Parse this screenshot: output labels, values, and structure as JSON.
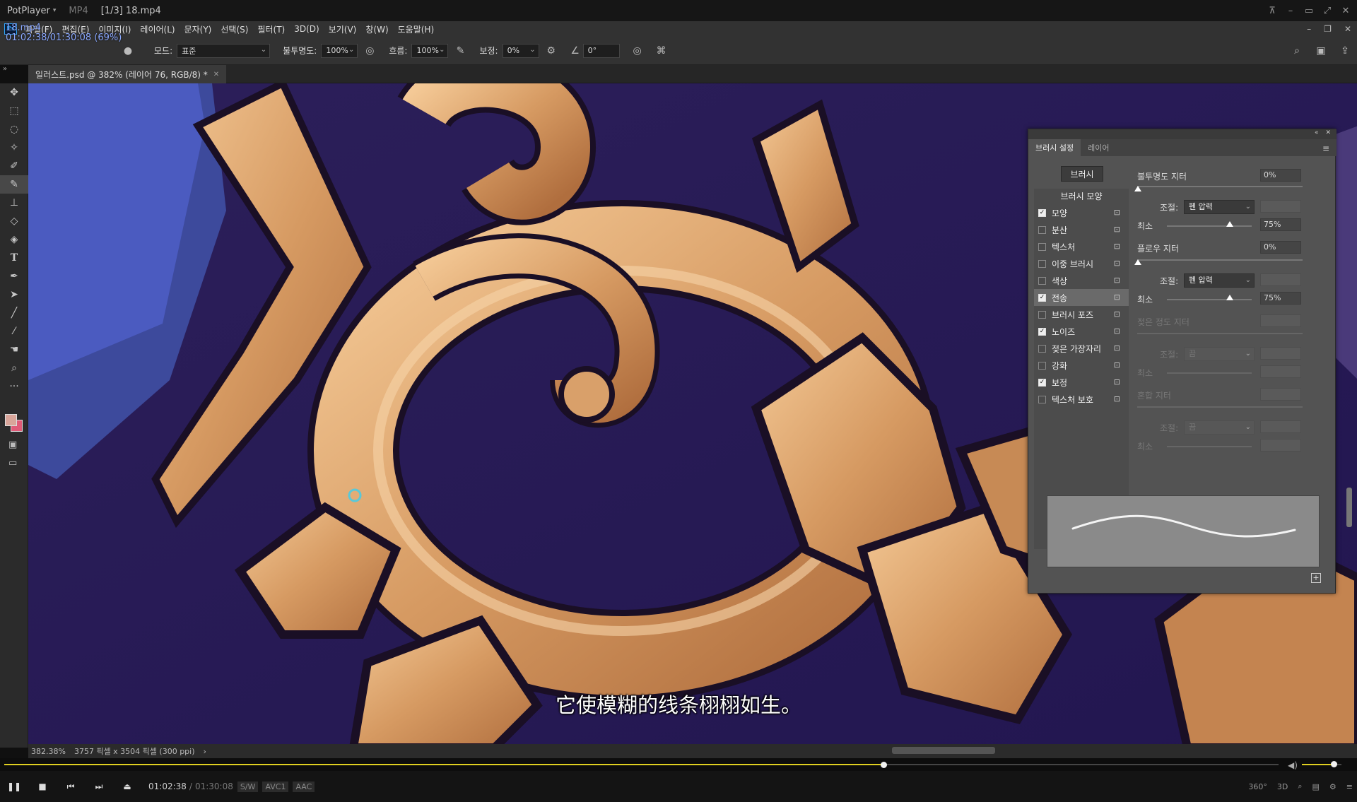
{
  "player": {
    "app_name": "PotPlayer",
    "format": "MP4",
    "title": "[1/3] 18.mp4",
    "osd_file": "18.mp4",
    "osd_time": "01:02:38/01:30:08 (69%)",
    "current_time": "01:02:38",
    "separator": "/",
    "duration": "01:30:08",
    "tags": [
      "S/W",
      "AVC1",
      "AAC"
    ],
    "progress_fraction": 0.69,
    "volume_fraction": 0.8,
    "right_buttons": [
      "360°",
      "3D"
    ],
    "subtitle": "它使模糊的线条栩栩如生。"
  },
  "photoshop": {
    "menu": [
      "파일(F)",
      "편집(E)",
      "이미지(I)",
      "레이어(L)",
      "문자(Y)",
      "선택(S)",
      "필터(T)",
      "3D(D)",
      "보기(V)",
      "창(W)",
      "도움말(H)"
    ],
    "options": {
      "mode_label": "모드:",
      "mode_value": "표준",
      "opacity_label": "불투명도:",
      "opacity_value": "100%",
      "flow_label": "흐름:",
      "flow_value": "100%",
      "smoothing_label": "보정:",
      "smoothing_value": "0%",
      "angle_value": "0°"
    },
    "doc_tab": "일러스트.psd @ 382% (레이어 76, RGB/8) *",
    "status_zoom": "382.38%",
    "status_info": "3757 픽셀 x 3504 픽셀 (300 ppi)",
    "status_arrow": "›",
    "fg_color": "#d9a59a",
    "bg_color": "#e05a78"
  },
  "brush_panel": {
    "tabs": [
      "브러시 설정",
      "레이어"
    ],
    "brush_button": "브러시",
    "shape_header": "브러시 모양",
    "items": [
      {
        "label": "모양",
        "checked": true
      },
      {
        "label": "분산",
        "checked": false
      },
      {
        "label": "텍스처",
        "checked": false
      },
      {
        "label": "이중 브러시",
        "checked": false
      },
      {
        "label": "색상",
        "checked": false
      },
      {
        "label": "전송",
        "checked": true,
        "selected": true
      },
      {
        "label": "브러시 포즈",
        "checked": false
      },
      {
        "label": "노이즈",
        "checked": true
      },
      {
        "label": "젖은 가장자리",
        "checked": false
      },
      {
        "label": "강화",
        "checked": false
      },
      {
        "label": "보정",
        "checked": true
      },
      {
        "label": "텍스처 보호",
        "checked": false
      }
    ],
    "opacity_jitter_label": "불투명도 지터",
    "opacity_jitter_value": "0%",
    "control_label": "조절:",
    "control_value": "펜 압력",
    "min_label": "최소",
    "min_value": "75%",
    "flow_jitter_label": "플로우 지터",
    "flow_jitter_value": "0%",
    "control2_value": "펜 압력",
    "min2_value": "75%",
    "wetness_jitter_label": "젖은 정도 지터",
    "control3_value": "끔",
    "min3_label": "최소",
    "mix_jitter_label": "혼합 지터",
    "control4_value": "끔",
    "min4_label": "최소"
  }
}
